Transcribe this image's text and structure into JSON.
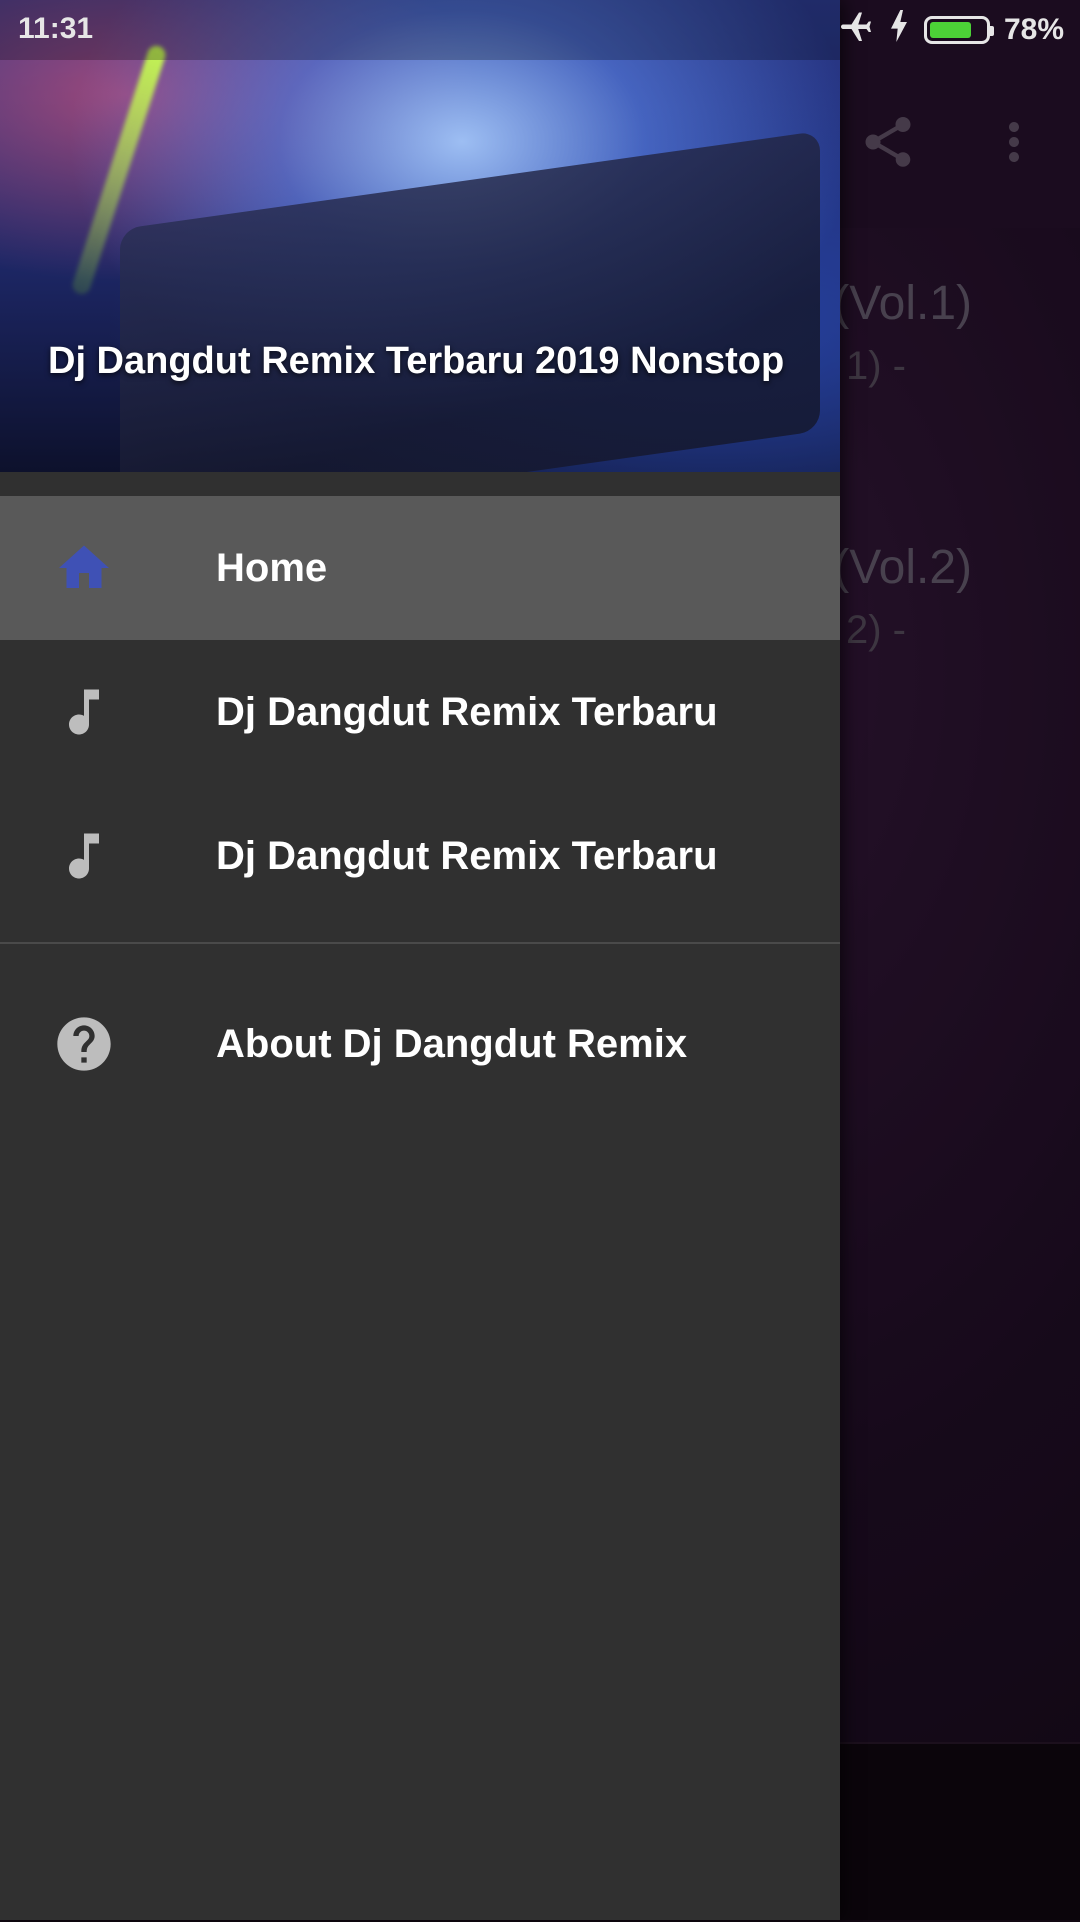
{
  "status_bar": {
    "time": "11:31",
    "battery_percent": "78%",
    "battery_level": 0.78,
    "icons": [
      "airplane-mode-icon",
      "charging-bolt-icon",
      "battery-icon"
    ]
  },
  "background_app": {
    "toolbar_icons": [
      "share-icon",
      "more-vert-icon"
    ],
    "items": [
      {
        "title_fragment": "(Vol.1)",
        "subtitle_fragment": "1) -"
      },
      {
        "title_fragment": "(Vol.2)",
        "subtitle_fragment": "2) -"
      }
    ]
  },
  "drawer": {
    "header_title": "Dj Dangdut Remix Terbaru 2019 Nonstop",
    "menu": [
      {
        "label": "Home",
        "icon": "home-icon",
        "active": true,
        "icon_color": "#3f51b5"
      },
      {
        "label": "Dj Dangdut Remix Terbaru",
        "icon": "music-note-icon",
        "active": false
      },
      {
        "label": "Dj Dangdut Remix Terbaru",
        "icon": "music-note-icon",
        "active": false
      }
    ],
    "secondary_menu": [
      {
        "label": "About Dj Dangdut Remix",
        "icon": "help-circle-icon"
      }
    ]
  },
  "colors": {
    "drawer_bg": "#303030",
    "active_item_bg": "#595959",
    "icon_grey": "#bdbdbd",
    "home_icon": "#3f51b5"
  }
}
